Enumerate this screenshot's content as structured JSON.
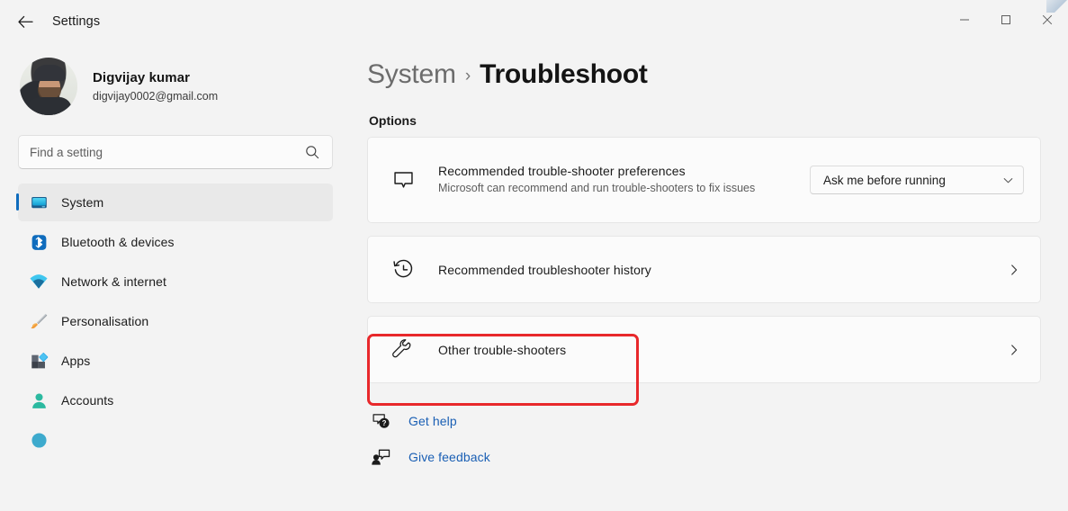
{
  "window": {
    "title": "Settings",
    "back_icon": "back-arrow-icon",
    "controls": {
      "minimize_label": "Minimize",
      "maximize_label": "Maximize",
      "close_label": "Close"
    }
  },
  "account": {
    "name": "Digvijay kumar",
    "email": "digvijay0002@gmail.com"
  },
  "search": {
    "placeholder": "Find a setting",
    "value": "",
    "icon": "search-icon"
  },
  "sidebar": {
    "items": [
      {
        "label": "System",
        "icon": "monitor-icon",
        "selected": true
      },
      {
        "label": "Bluetooth & devices",
        "icon": "bluetooth-icon",
        "selected": false
      },
      {
        "label": "Network & internet",
        "icon": "wifi-icon",
        "selected": false
      },
      {
        "label": "Personalisation",
        "icon": "paintbrush-icon",
        "selected": false
      },
      {
        "label": "Apps",
        "icon": "apps-icon",
        "selected": false
      },
      {
        "label": "Accounts",
        "icon": "person-icon",
        "selected": false
      }
    ]
  },
  "breadcrumb": {
    "parent": "System",
    "separator": "›",
    "current": "Troubleshoot"
  },
  "main": {
    "section_label": "Options",
    "cards": [
      {
        "title": "Recommended trouble-shooter preferences",
        "description": "Microsoft can recommend and run trouble-shooters to fix issues",
        "icon": "chat-bubble-icon",
        "control": "dropdown",
        "dropdown_value": "Ask me before running",
        "dropdown_chevron": "chevron-down-icon"
      },
      {
        "title": "Recommended troubleshooter history",
        "description": "",
        "icon": "history-clock-icon",
        "control": "chevron",
        "chevron": "chevron-right-icon"
      },
      {
        "title": "Other trouble-shooters",
        "description": "",
        "icon": "wrench-icon",
        "control": "chevron",
        "chevron": "chevron-right-icon",
        "highlighted": true
      }
    ]
  },
  "footer_links": [
    {
      "label": "Get help",
      "icon": "help-question-icon"
    },
    {
      "label": "Give feedback",
      "icon": "feedback-person-icon"
    }
  ],
  "colors": {
    "accent": "#0f6cbd",
    "link": "#1a5fb4",
    "highlight": "#e8282b",
    "page_bg": "#f3f3f3",
    "card_bg": "#fbfbfb"
  }
}
